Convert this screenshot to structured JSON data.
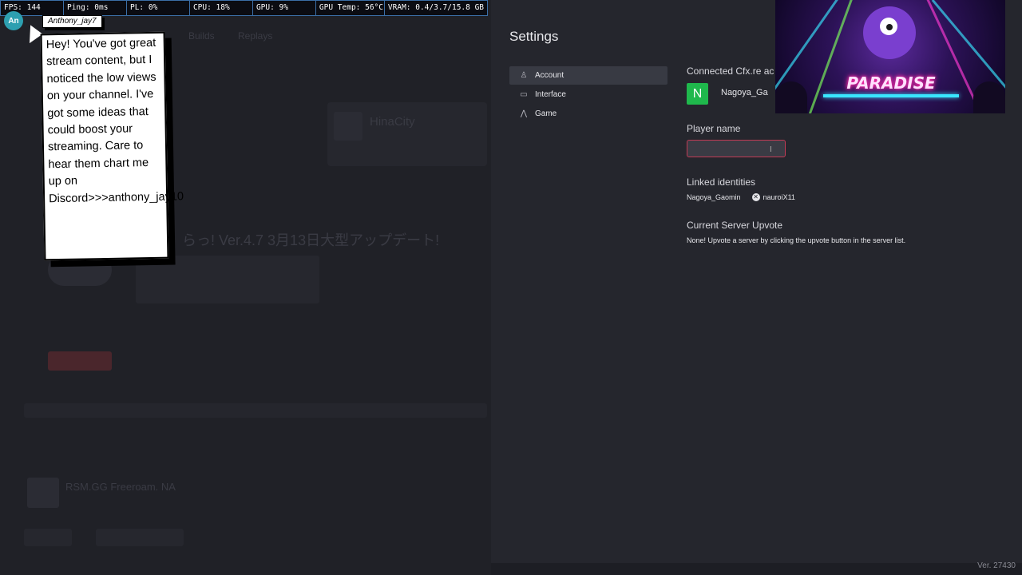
{
  "perf": {
    "fps": "FPS: 144",
    "ping": "Ping: 0ms",
    "pl": "PL: 0%",
    "cpu": "CPU: 18%",
    "gpu": "GPU: 9%",
    "gpu_temp": "GPU Temp: 56°C",
    "vram": "VRAM: 0.4/3.7/15.8 GB"
  },
  "chat": {
    "avatar_initials": "An",
    "username": "Anthony_jay7",
    "message": "Hey! You've got great stream content, but I noticed the low views on your channel. I've got some ideas that could boost your streaming. Care to hear them chart me up on Discord>>>anthony_jay10"
  },
  "background": {
    "server_name": "HinaCity",
    "banner_text": "らっ! Ver.4.7 3月13日大型アップデート!",
    "tab_1": "Builds",
    "tab_2": "Replays",
    "featured_server": "RSM.GG Freeroam. NA"
  },
  "settings": {
    "title": "Settings",
    "nav": [
      {
        "label": "Account",
        "icon": "person-icon",
        "glyph": "♙"
      },
      {
        "label": "Interface",
        "icon": "monitor-icon",
        "glyph": "▭"
      },
      {
        "label": "Game",
        "icon": "game-icon",
        "glyph": "⋀"
      }
    ],
    "account": {
      "heading": "Connected Cfx.re ac",
      "badge_letter": "N",
      "badge_color": "#1fb84c",
      "name": "Nagoya_Ga"
    },
    "player_name": {
      "heading": "Player name",
      "value": ""
    },
    "linked": {
      "heading": "Linked identities",
      "primary": "Nagoya_Gaomin",
      "xbox": "nauroiX11"
    },
    "upvote": {
      "heading": "Current Server Upvote",
      "text": "None! Upvote a server by clicking the upvote button in the server list."
    }
  },
  "thumbnail": {
    "title": "PARADISE"
  },
  "version": "Ver. 27430",
  "colors": {
    "accent_error": "#c23a55",
    "perf_border": "#3b6ea6"
  }
}
